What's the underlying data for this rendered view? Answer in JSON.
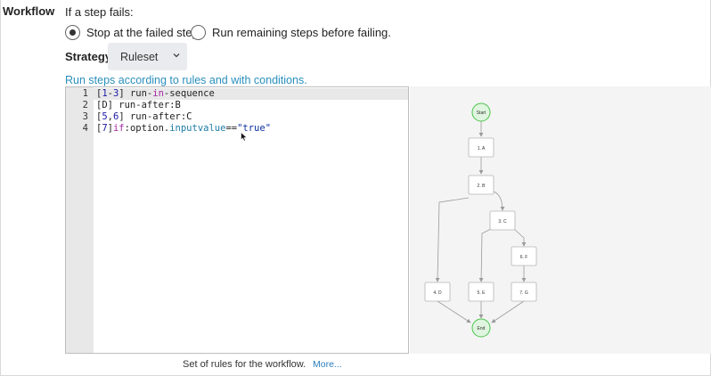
{
  "section": {
    "label": "Workflow"
  },
  "failure": {
    "title": "If a step fails:",
    "options": [
      {
        "label": "Stop at the failed step.",
        "selected": true
      },
      {
        "label": "Run remaining steps before failing.",
        "selected": false
      }
    ]
  },
  "strategy": {
    "label": "Strategy:",
    "value": "Ruleset"
  },
  "hint": "Run steps according to rules and with conditions.",
  "editor": {
    "lines": [
      {
        "n": "1",
        "text": "[1-3] run-in-sequence"
      },
      {
        "n": "2",
        "text": "[D] run-after:B"
      },
      {
        "n": "3",
        "text": "[5,6] run-after:C"
      },
      {
        "n": "4",
        "text": "[7]if:option.inputvalue==\"true\""
      }
    ]
  },
  "diagram": {
    "start_label": "Start",
    "end_label": "End",
    "nodes": {
      "a": "1. A",
      "b": "2. B",
      "c": "3. C",
      "d": "4. D",
      "e": "5. E",
      "f": "6. F",
      "g": "7. G"
    },
    "colors": {
      "terminal_fill": "#dff5df",
      "terminal_stroke": "#4cc44c",
      "edge": "#9a9a9a"
    }
  },
  "footer": {
    "text": "Set of rules for the workflow.",
    "more": "More..."
  }
}
